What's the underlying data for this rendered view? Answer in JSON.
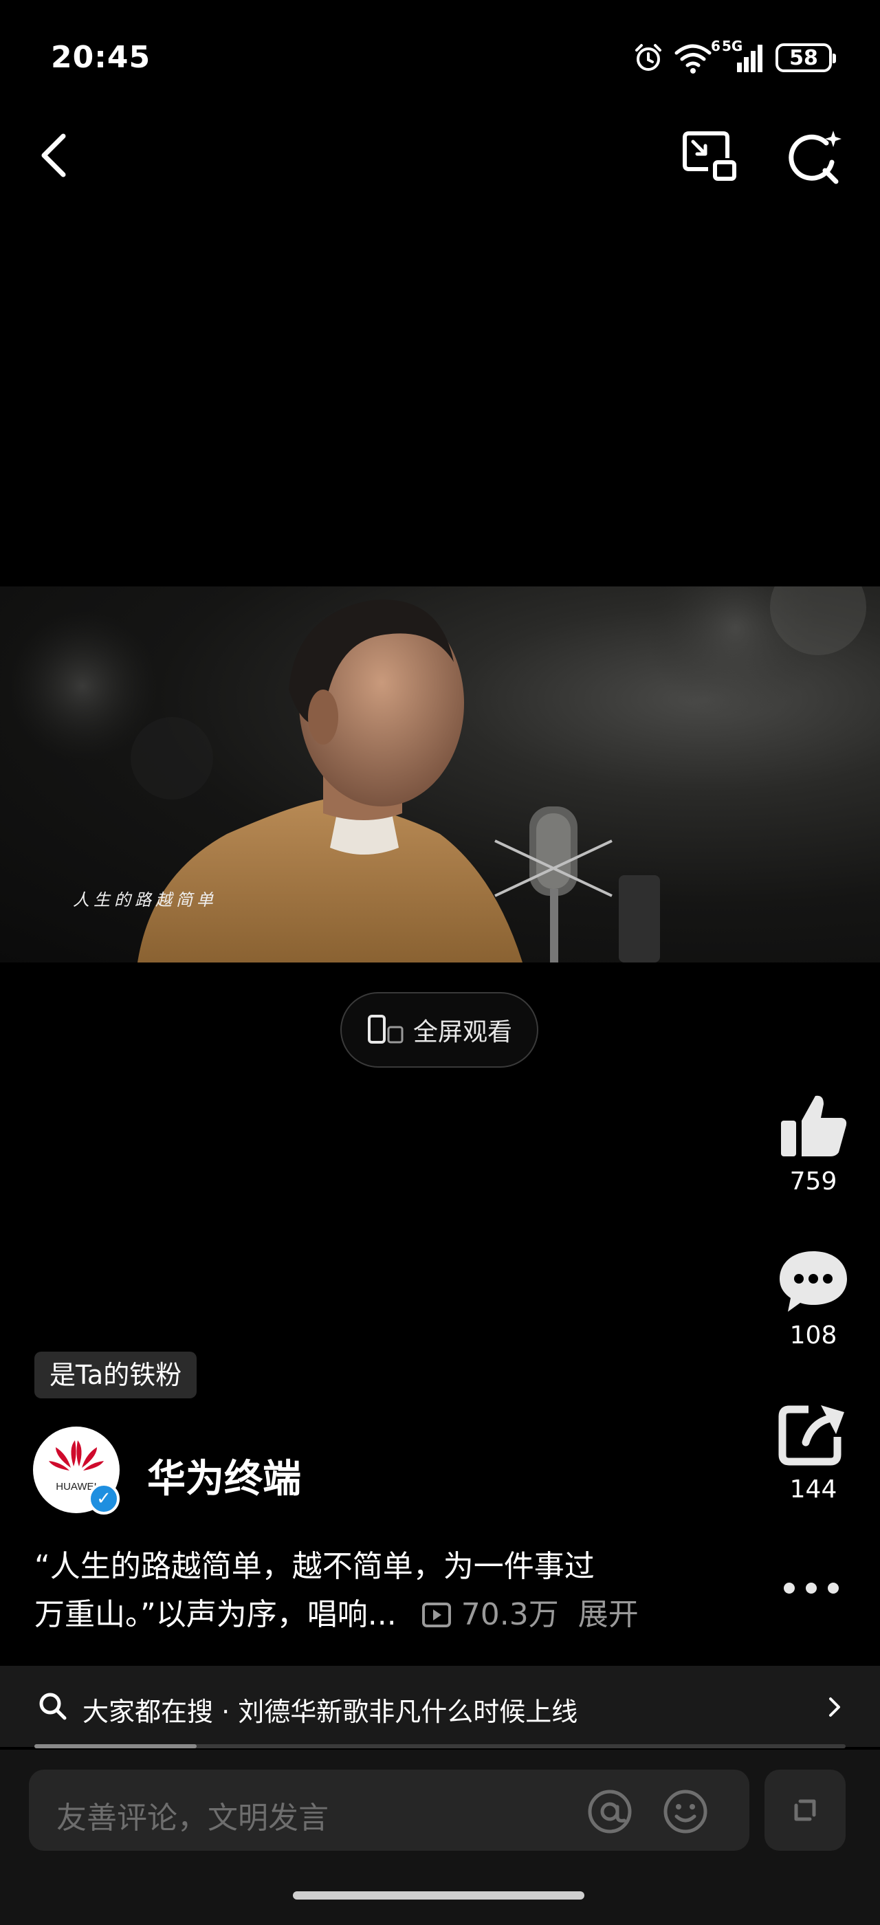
{
  "status_bar": {
    "time": "20:45",
    "network": "5G",
    "network_sub": "6",
    "battery": "58"
  },
  "video": {
    "subtitle": "人生的路越简单"
  },
  "fullscreen_label": "全屏观看",
  "actions": {
    "likes": "759",
    "comments": "108",
    "shares": "144"
  },
  "fan_badge": "是Ta的铁粉",
  "author": {
    "name": "华为终端",
    "logo_text": "HUAWEI"
  },
  "description": {
    "line1": "“人生的路越简单，越不简单，为一件事过",
    "line2": "万重山。”以声为序，唱响...",
    "views": "70.3万",
    "expand": "展开"
  },
  "hot_search": {
    "text": "大家都在搜 · 刘德华新歌非凡什么时候上线"
  },
  "playback_progress": 0.2,
  "comment": {
    "placeholder": "友善评论，文明发言"
  },
  "colors": {
    "background": "#000000",
    "badge": "#2b2b2b",
    "verified": "#1e8fe0",
    "huawei_red": "#cf0a2c"
  }
}
